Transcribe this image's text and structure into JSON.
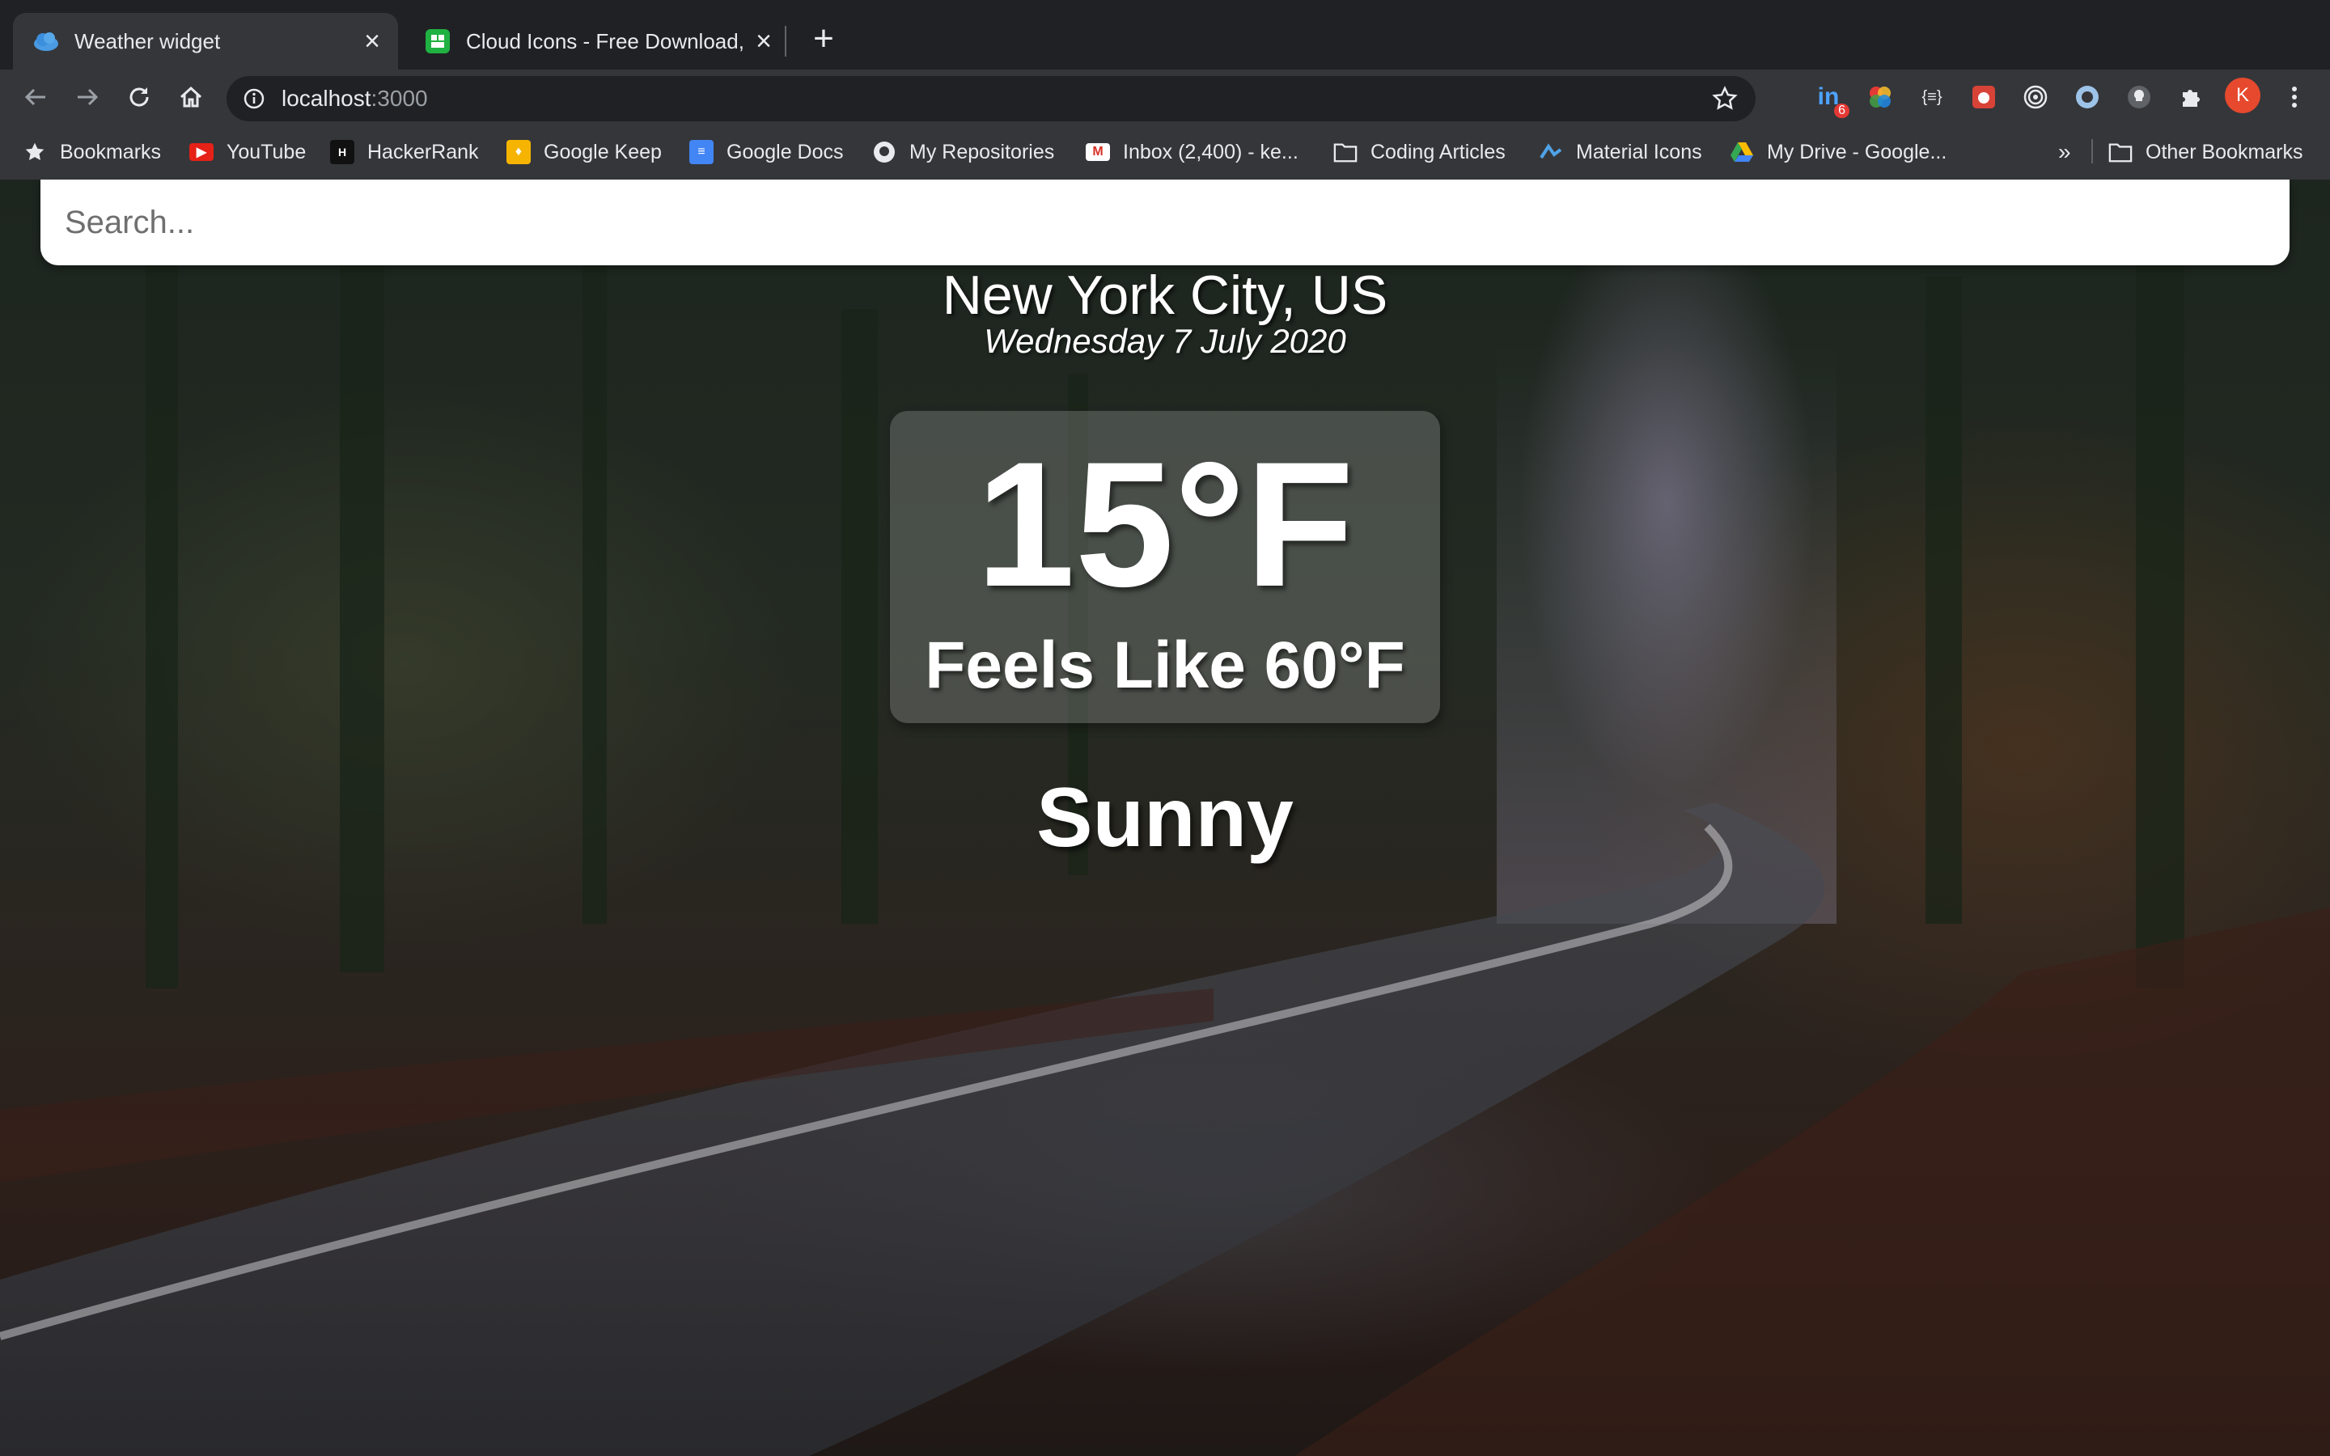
{
  "browser": {
    "tabs": [
      {
        "title": "Weather widget",
        "icon": "cloud-icon",
        "active": true
      },
      {
        "title": "Cloud Icons - Free Download, P",
        "icon": "icons8-icon",
        "active": false
      }
    ],
    "address": {
      "host": "localhost",
      "port": ":3000"
    },
    "profile_initial": "K",
    "extension_badge": "6",
    "bookmarks": [
      {
        "label": "Bookmarks",
        "icon": "star-icon"
      },
      {
        "label": "YouTube",
        "icon": "youtube-icon"
      },
      {
        "label": "HackerRank",
        "icon": "hackerrank-icon"
      },
      {
        "label": "Google Keep",
        "icon": "google-keep-icon"
      },
      {
        "label": "Google Docs",
        "icon": "google-docs-icon"
      },
      {
        "label": "My Repositories",
        "icon": "github-icon"
      },
      {
        "label": "Inbox (2,400) - ke...",
        "icon": "gmail-icon"
      },
      {
        "label": "Coding Articles",
        "icon": "folder-icon"
      },
      {
        "label": "Material Icons",
        "icon": "material-icon"
      },
      {
        "label": "My Drive - Google...",
        "icon": "google-drive-icon"
      }
    ],
    "overflow_label": "»",
    "other_bookmarks": "Other Bookmarks"
  },
  "app": {
    "search_placeholder": "Search...",
    "location": "New York City, US",
    "date": "Wednesday 7 July 2020",
    "temperature": "15°F",
    "feels_like": "Feels Like 60°F",
    "condition": "Sunny"
  }
}
